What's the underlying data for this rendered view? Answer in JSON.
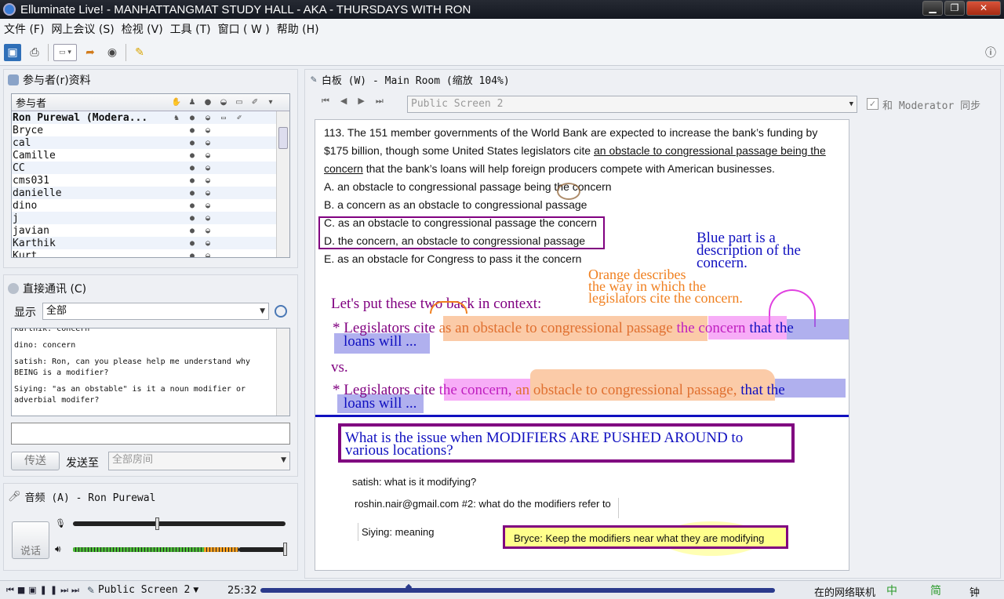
{
  "app": {
    "title": "Elluminate Live! - MANHATTANGMAT STUDY HALL - AKA - THURSDAYS WITH RON",
    "window_controls": [
      "minimize",
      "restore",
      "close"
    ]
  },
  "menu": [
    "文件 (F)",
    "网上会议 (S)",
    "检视 (V)",
    "工具 (T)",
    "窗口 ( W )",
    "帮助 (H)"
  ],
  "participants": {
    "title": "参与者(r)资料",
    "header": "参与者",
    "list": [
      "Ron Purewal (Modera...",
      "Bryce",
      "cal",
      "Camille",
      "CC",
      "cms031",
      "danielle",
      "dino",
      "j",
      "javian",
      "Karthik",
      "Kurt"
    ]
  },
  "chat": {
    "title": "直接通讯 (C)",
    "show_label": "显示",
    "show_value": "全部",
    "messages": [
      "karthik: concern",
      "dino: concern",
      "satish: Ron, can you please help me understand why BEING is a modifier?",
      "Siying: \"as an obstable\" is it a noun modifier or adverbial modifer?"
    ],
    "send_label": "传送",
    "send_to_label": "发送至",
    "send_to_value": "全部房间",
    "input_value": ""
  },
  "audio": {
    "title": "音频 (A) - Ron Purewal",
    "talk_label": "说话",
    "mic_level": 0.4
  },
  "whiteboard": {
    "title": "白板 (W) - Main Room (缩放 104%)",
    "screen": "Public Screen 2",
    "sync_label": "和 Moderator 同步",
    "sync_checked": true
  },
  "question": {
    "line1": "113. The 151 member governments of the World Bank are expected to increase the bank’s funding by",
    "line2_a": "$175 billion, though some United States legislators cite ",
    "line2_u": "an obstacle to congressional passage being the",
    "line3_u": "concern",
    "line3_b": " that the bank’s loans will help foreign producers compete with American businesses.",
    "options": [
      "A. an obstacle to congressional passage being the concern",
      "B. a concern as an obstacle to congressional passage",
      "C. as an obstacle to congressional passage the concern",
      "D. the concern, an obstacle to congressional passage",
      "E. as an obstacle for Congress to pass it the concern"
    ]
  },
  "annotations": {
    "blue_note": [
      "Blue part is a",
      "description of the",
      "concern."
    ],
    "orange_note": [
      "Orange describes",
      "the way in which the",
      "legislators cite the concern."
    ],
    "context": "Let's put these two back in context:",
    "s1_a": "* Legislators cite ",
    "s1_orange": "as an obstacle to congressional passage",
    "s1_pink": "the concern",
    "s1_blue": "that the",
    "s1_blue2": "loans will ...",
    "vs": "vs.",
    "s2_a": "* Legislators cite ",
    "s2_pink": "the concern,",
    "s2_orange": "an obstacle to congressional passage,",
    "s2_blue": "that the",
    "s2_blue2": "loans will ...",
    "issue": [
      "What is the issue when MODIFIERS ARE PUSHED AROUND to",
      "various locations?"
    ]
  },
  "notes": {
    "satish": "satish: what is it modifying?",
    "roshin": "roshin.nair@gmail.com #2: what do the modifiers refer to",
    "siying": "Siying: meaning",
    "bryce": "Bryce: Keep the modifiers near what they are modifying"
  },
  "statusbar": {
    "screen": "Public Screen 2",
    "time": "25:32",
    "network": "在的网络联机",
    "ime": "中",
    "ime2": "简",
    "tail": "钟"
  },
  "colors": {
    "purple": "#800080",
    "blue": "#1010c0",
    "orange": "#f08020",
    "pink": "#e040e0"
  }
}
